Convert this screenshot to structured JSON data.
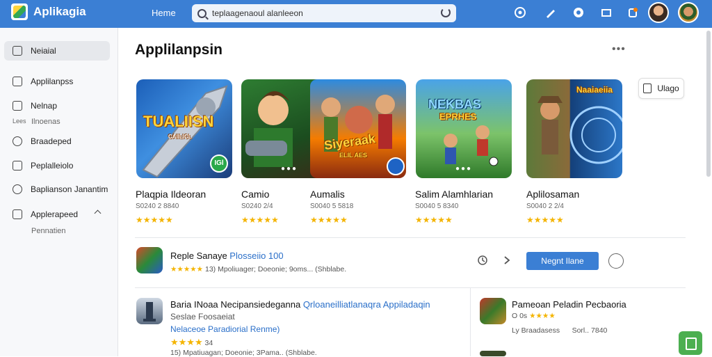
{
  "header": {
    "app_title": "Aplikagia",
    "nav_home": "Heme",
    "search_value": "teplaagenaoul alanleeon"
  },
  "sidebar": {
    "items": [
      {
        "label": "Neiaial"
      },
      {
        "label": "Applilanpss"
      },
      {
        "label": "Nelnap"
      },
      {
        "label": "Braadeped"
      },
      {
        "label": "Peplalleiolo"
      },
      {
        "label": "Baplianson Janantim"
      },
      {
        "label": "Applerapeed"
      }
    ],
    "sub_labels": {
      "nelnap_left": "Lees",
      "nelnap_right": "Ilnoenas",
      "applerapeed": "Pennatien"
    }
  },
  "main": {
    "title": "Applilanpsin",
    "more": "•••",
    "usage_button": "Ulago",
    "cards": [
      {
        "title": "Plaqpia Ildeoran",
        "meta": "S0240 2 8840",
        "stars": "★★★★★",
        "art": "TUALIISN",
        "art_sub": "CAIILICL",
        "badge": "IGl"
      },
      {
        "title": "Camio",
        "meta": "S0240 2/4",
        "stars": "★★★★★",
        "art": "",
        "art_sub": "",
        "badge": ""
      },
      {
        "title": "Aumalis",
        "meta": "S0040 5 5818",
        "stars": "★★★★★",
        "art": "Siyeraak",
        "art_sub": "ELIL AES",
        "badge": ""
      },
      {
        "title": "Salim Alamhlarian",
        "meta": "S0040 5 8340",
        "stars": "★★★★★",
        "art": "NEKBAS",
        "art_sub": "EPRHES",
        "badge": ""
      },
      {
        "title": "Aplilosaman",
        "meta": "S0040 2 2/4",
        "stars": "★★★★★",
        "art": "Naaiaeiia",
        "art_sub": "",
        "badge": ""
      }
    ],
    "featured": {
      "title": "Reple Sanaye",
      "title_link": "Plosseiio 100",
      "stars": "★★★★★",
      "meta": "13) Mpoliuager; Doeonie; 9oms... (Shblabe.",
      "button": "Negnt Ilane"
    },
    "list_left": {
      "title": "Baria INoaa Necipansiedeganna",
      "title_link": "Qrloaneilliatlanaqra Appiladaqin",
      "line2": "Seslae Foosaeiat",
      "line3_link": "Nelaceoe Paradiorial Renme)",
      "stars": "★★★★",
      "rating": "34",
      "meta": "15) Mpatiuagan; Doeonie; 3Pama.. (Shblabe."
    },
    "list_right": {
      "title": "Pameoan Peladin Pecbaoria",
      "meta_left": "O 0s",
      "stars": "★★★★",
      "meta_mid": "Ly Braadasess",
      "meta_right": "Sorl.. 7840"
    }
  },
  "colors": {
    "accent": "#3b7fd4",
    "star": "#f4b400",
    "link": "#2a6fc9",
    "fab": "#4caf50"
  }
}
